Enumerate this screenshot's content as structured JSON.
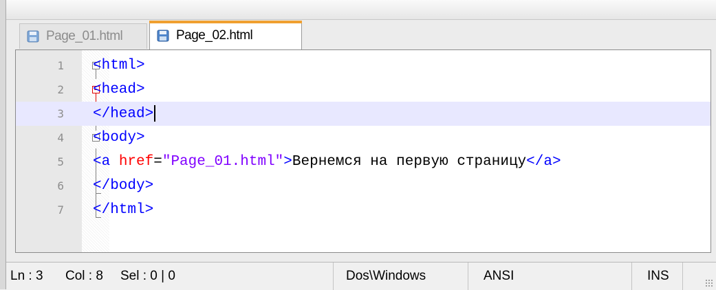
{
  "tabs": [
    {
      "label": "Page_01.html",
      "active": false
    },
    {
      "label": "Page_02.html",
      "active": true
    }
  ],
  "editor": {
    "current_line": 3,
    "lines": [
      {
        "num": "1"
      },
      {
        "num": "2"
      },
      {
        "num": "3"
      },
      {
        "num": "4"
      },
      {
        "num": "5"
      },
      {
        "num": "6"
      },
      {
        "num": "7"
      }
    ],
    "code": {
      "l1": "<html>",
      "l2": "<head>",
      "l3": "</head>",
      "l4": "<body>",
      "l5_open": "<a ",
      "l5_attr": "href",
      "l5_eq": "=",
      "l5_str": "\"Page_01.html\"",
      "l5_close": ">",
      "l5_text": "Вернемся на первую страницу",
      "l5_end": "</a>",
      "l6": "</body>",
      "l7": "</html>"
    }
  },
  "statusbar": {
    "ln": "Ln : 3",
    "col": "Col : 8",
    "sel": "Sel : 0 | 0",
    "eol": "Dos\\Windows",
    "encoding": "ANSI",
    "mode": "INS"
  },
  "colors": {
    "tag": "#0000ff",
    "attribute": "#ff0000",
    "string": "#8000ff",
    "current_line": "#e8e8ff",
    "active_tab_accent": "#f0a030"
  },
  "icons": [
    "floppy-disk-icon",
    "fold-minus-icon",
    "resize-grip-icon"
  ]
}
